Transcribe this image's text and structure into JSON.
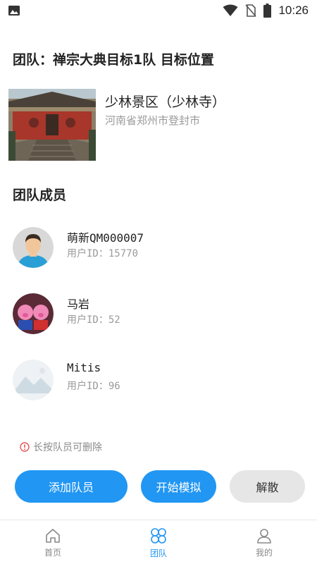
{
  "status_bar": {
    "time": "10:26",
    "left_icon": "image-icon",
    "right_icons": [
      "wifi-icon",
      "no-sim-icon",
      "battery-icon"
    ]
  },
  "header": {
    "title": "团队：禅宗大典目标1队  目标位置"
  },
  "location": {
    "name": "少林景区（少林寺）",
    "address": "河南省郑州市登封市",
    "image": "shaolin-temple-photo"
  },
  "members_section": {
    "title": "团队成员"
  },
  "members": [
    {
      "name": "萌新QM000007",
      "id_text": "用户ID：15770",
      "avatar": "default-man-avatar"
    },
    {
      "name": "马岩",
      "id_text": "用户ID：52",
      "avatar": "pig-toys-avatar"
    },
    {
      "name": "Mitis",
      "id_text": "用户ID：96",
      "avatar": "landscape-avatar"
    }
  ],
  "hint": {
    "text": "长按队员可删除",
    "icon": "alert-circle-icon"
  },
  "buttons": {
    "add_member": "添加队员",
    "start_sim": "开始模拟",
    "disband": "解散"
  },
  "tabs": [
    {
      "label": "首页",
      "icon": "home-icon",
      "active": false
    },
    {
      "label": "团队",
      "icon": "team-icon",
      "active": true
    },
    {
      "label": "我的",
      "icon": "person-icon",
      "active": false
    }
  ],
  "colors": {
    "accent": "#2196f3",
    "secondary_button": "#e6e6e6",
    "hint": "#e55555"
  }
}
